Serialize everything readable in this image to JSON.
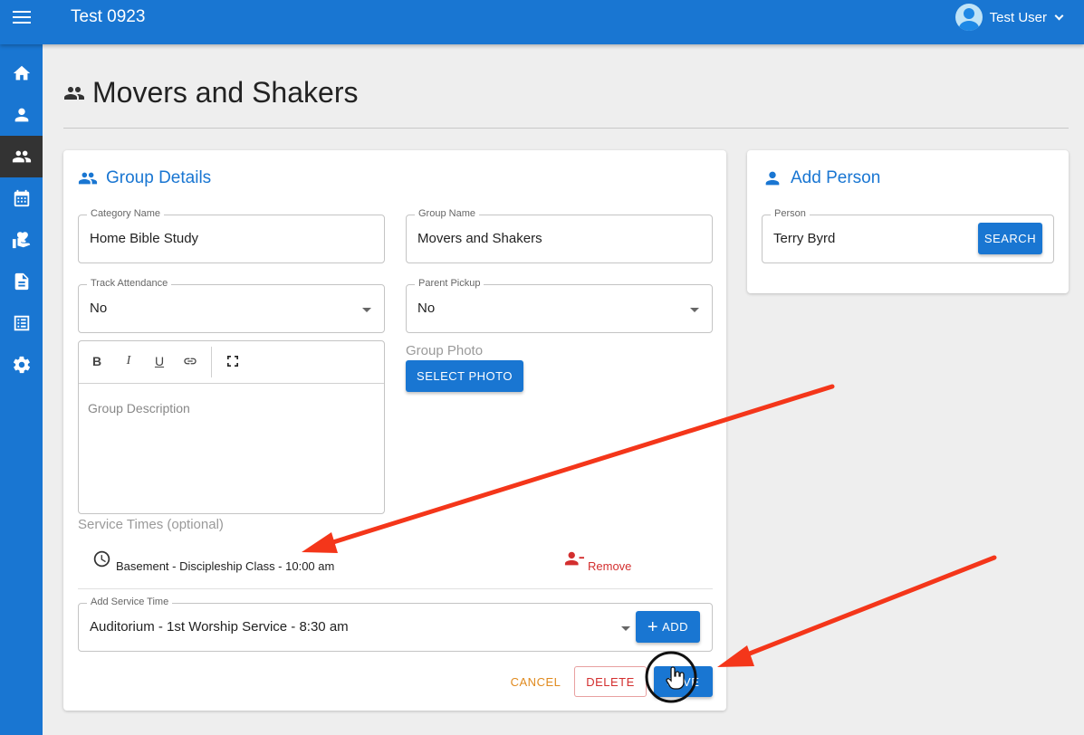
{
  "app": {
    "title": "Test 0923"
  },
  "user": {
    "name": "Test User"
  },
  "sidebar": {
    "items": [
      {
        "icon": "home-icon"
      },
      {
        "icon": "person-icon"
      },
      {
        "icon": "groups-icon",
        "active": true
      },
      {
        "icon": "calendar-icon"
      },
      {
        "icon": "donation-icon"
      },
      {
        "icon": "document-icon"
      },
      {
        "icon": "list-icon"
      },
      {
        "icon": "settings-icon"
      }
    ]
  },
  "page": {
    "title": "Movers and Shakers"
  },
  "group_details": {
    "header": "Group Details",
    "category": {
      "label": "Category Name",
      "value": "Home Bible Study"
    },
    "group_name": {
      "label": "Group Name",
      "value": "Movers and Shakers"
    },
    "track_attendance": {
      "label": "Track Attendance",
      "value": "No"
    },
    "parent_pickup": {
      "label": "Parent Pickup",
      "value": "No"
    },
    "editor": {
      "buttons": {
        "bold": "B",
        "italic": "I",
        "underline": "U"
      },
      "placeholder": "Group Description"
    },
    "photo": {
      "label": "Group Photo",
      "button": "SELECT PHOTO"
    },
    "service_times": {
      "label": "Service Times (optional)",
      "items": [
        {
          "text": "Basement - Discipleship Class - 10:00 am",
          "remove_label": "Remove"
        }
      ]
    },
    "add_service_time": {
      "label": "Add Service Time",
      "value": "Auditorium - 1st Worship Service - 8:30 am",
      "button": "ADD"
    },
    "actions": {
      "cancel": "CANCEL",
      "delete": "DELETE",
      "save": "SAVE"
    }
  },
  "add_person": {
    "header": "Add Person",
    "person": {
      "label": "Person",
      "value": "Terry Byrd"
    },
    "search_button": "SEARCH"
  },
  "colors": {
    "primary": "#1976d2",
    "danger": "#d32f2f",
    "cancel": "#e08a1e",
    "annotation_arrow": "#f4361a"
  }
}
